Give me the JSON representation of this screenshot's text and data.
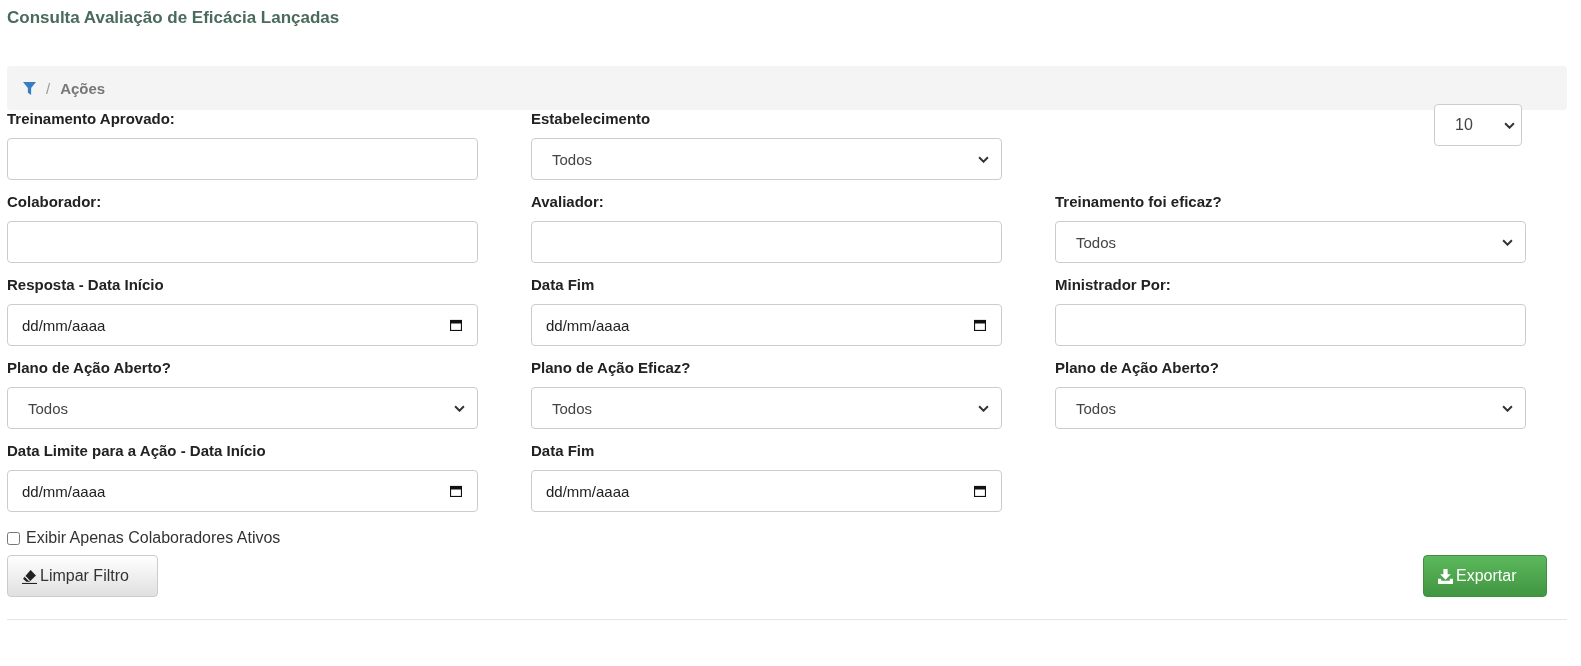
{
  "page_title": "Consulta Avaliação de Eficácia Lançadas",
  "breadcrumb": {
    "separator": "/",
    "items": [
      "Ações"
    ]
  },
  "rows": [
    [
      {
        "kind": "text",
        "label": "Treinamento Aprovado:"
      },
      {
        "kind": "select",
        "label": "Estabelecimento",
        "value": "Todos"
      },
      {
        "kind": "pagesize",
        "value": "10"
      }
    ],
    [
      {
        "kind": "text",
        "label": "Colaborador:"
      },
      {
        "kind": "text",
        "label": "Avaliador:"
      },
      {
        "kind": "select",
        "label": "Treinamento foi eficaz?",
        "value": "Todos"
      }
    ],
    [
      {
        "kind": "date",
        "label": "Resposta - Data Início",
        "placeholder": "dd/mm/aaaa"
      },
      {
        "kind": "date",
        "label": "Data Fim",
        "placeholder": "dd/mm/aaaa"
      },
      {
        "kind": "text",
        "label": "Ministrador Por:"
      }
    ],
    [
      {
        "kind": "select",
        "label": "Plano de Ação Aberto?",
        "value": "Todos"
      },
      {
        "kind": "select",
        "label": "Plano de Ação Eficaz?",
        "value": "Todos"
      },
      {
        "kind": "select",
        "label": "Plano de Ação Aberto?",
        "value": "Todos"
      }
    ],
    [
      {
        "kind": "date",
        "label": "Data Limite para a Ação - Data Início",
        "placeholder": "dd/mm/aaaa"
      },
      {
        "kind": "date",
        "label": "Data Fim",
        "placeholder": "dd/mm/aaaa"
      },
      {
        "kind": "empty"
      }
    ]
  ],
  "active_only": {
    "label": "Exibir Apenas Colaboradores Ativos",
    "checked": false
  },
  "buttons": {
    "clear": "Limpar Filtro",
    "export": "Exportar"
  }
}
